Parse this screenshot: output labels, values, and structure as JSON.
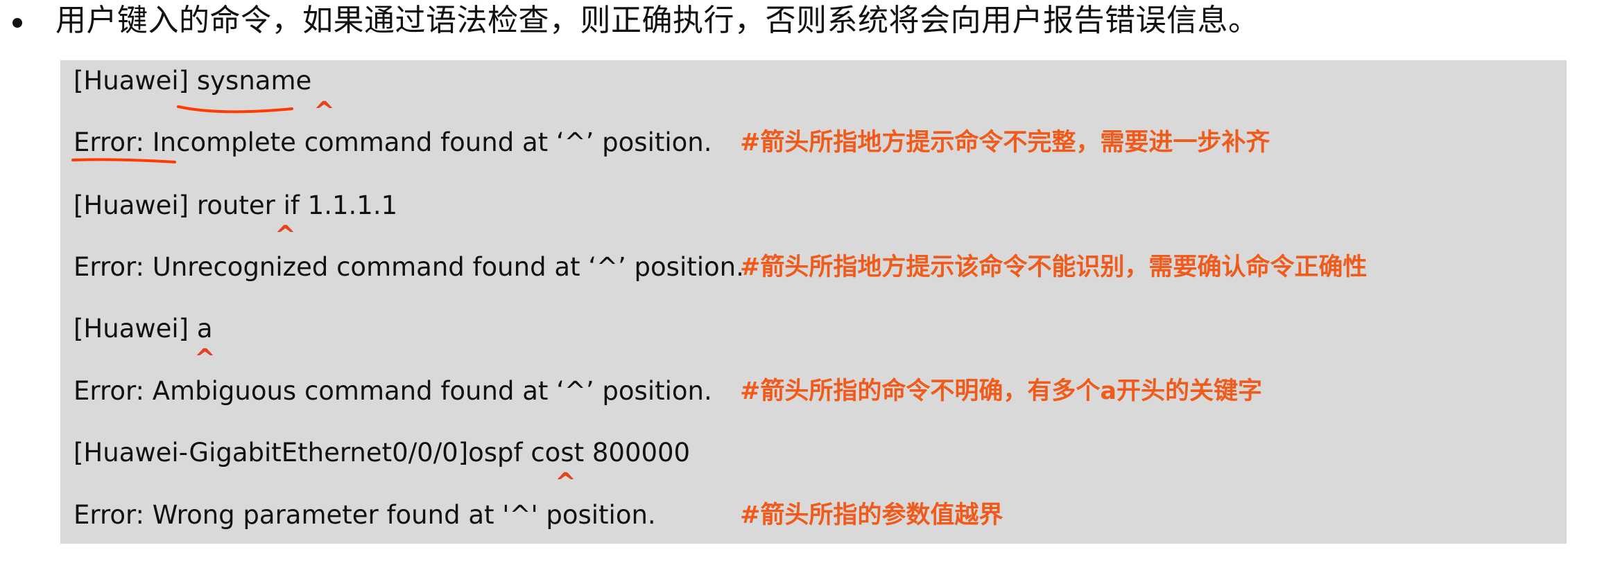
{
  "intro": {
    "text": "用户键入的命令，如果通过语法检查，则正确执行，否则系统将会向用户报告错误信息。"
  },
  "colors": {
    "box_bg": "#d9d9d9",
    "caret": "#e6421b",
    "comment": "#f05a1a",
    "annotation": "#ff3b00"
  },
  "examples": [
    {
      "command": "[Huawei] sysname",
      "caret": "^",
      "error": "Error: Incomplete command found at ‘^’ position.",
      "comment": "#箭头所指地方提示命令不完整，需要进一步补齐"
    },
    {
      "command": "[Huawei] router if 1.1.1.1",
      "caret": "^",
      "error": "Error: Unrecognized command found at ‘^’ position.",
      "comment": "#箭头所指地方提示该命令不能识别，需要确认命令正确性"
    },
    {
      "command": "[Huawei] a",
      "caret": "^",
      "error": "Error: Ambiguous command found at ‘^’ position.",
      "comment": "#箭头所指的命令不明确，有多个a开头的关键字"
    },
    {
      "command": "[Huawei-GigabitEthernet0/0/0]ospf cost 800000",
      "caret": "^",
      "error": "Error: Wrong parameter found at '^' position.",
      "comment": "#箭头所指的参数值越界"
    }
  ]
}
